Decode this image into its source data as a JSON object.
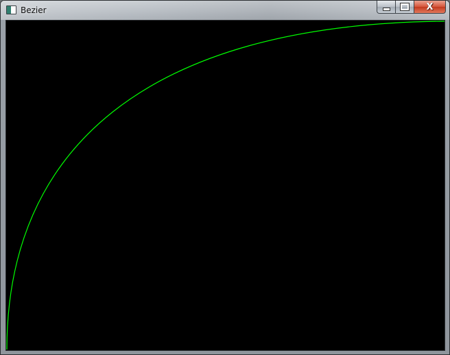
{
  "window": {
    "title": "Bezier",
    "icon": "application-icon",
    "buttons": {
      "minimize_icon": "minimize-icon",
      "maximize_icon": "maximize-icon",
      "close_icon": "close-icon",
      "close_glyph": "X"
    }
  },
  "canvas": {
    "background": "#000000",
    "curve_color": "#00ff00",
    "curve_shape": "bezier"
  }
}
